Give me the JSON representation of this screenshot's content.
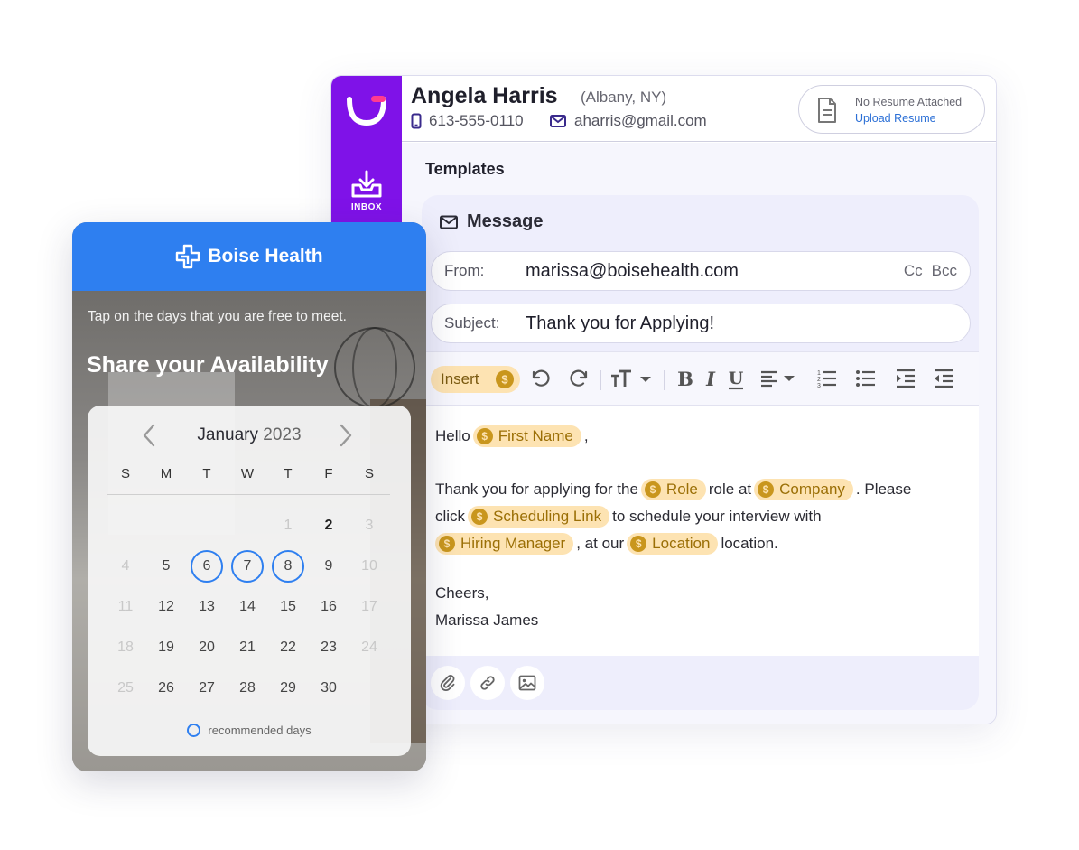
{
  "contact": {
    "name": "Angela Harris",
    "location": "(Albany, NY)",
    "phone": "613-555-0110",
    "email": "aharris@gmail.com",
    "resume_status": "No Resume Attached",
    "resume_action": "Upload Resume"
  },
  "sidebar": {
    "inbox_label": "INBOX"
  },
  "templates_title": "Templates",
  "message": {
    "title": "Message",
    "from_label": "From:",
    "from_value": "marissa@boisehealth.com",
    "cc_label": "Cc",
    "bcc_label": "Bcc",
    "subject_label": "Subject:",
    "subject_value": "Thank you for Applying!",
    "insert_label": "Insert",
    "body": {
      "greeting": "Hello",
      "greeting_end": ",",
      "p1_a": "Thank you for applying for the",
      "p1_b": "role at",
      "p1_c": ". Please",
      "p2_a": "click",
      "p2_b": "to schedule your interview with",
      "p3_b": ", at our",
      "p3_c": "location.",
      "signoff": "Cheers,",
      "signature": "Marissa James"
    },
    "tokens": {
      "first_name": "First Name",
      "role": "Role",
      "company": "Company",
      "scheduling_link": "Scheduling Link",
      "hiring_manager": "Hiring Manager",
      "location": "Location"
    }
  },
  "availability": {
    "brand": "Boise Health",
    "instruction": "Tap on the days that you are free to meet.",
    "title": "Share your Availability",
    "month": "January",
    "year": "2023",
    "weekdays": [
      "S",
      "M",
      "T",
      "W",
      "T",
      "F",
      "S"
    ],
    "weeks": [
      [
        null,
        null,
        null,
        null,
        "1",
        "2",
        "3"
      ],
      [
        "4",
        "5",
        "6",
        "7",
        "8",
        "9",
        "10"
      ],
      [
        "11",
        "12",
        "13",
        "14",
        "15",
        "16",
        "17"
      ],
      [
        "18",
        "19",
        "20",
        "21",
        "22",
        "23",
        "24"
      ],
      [
        "25",
        "26",
        "27",
        "28",
        "29",
        "30",
        null
      ]
    ],
    "recommended_days": [
      "6",
      "7",
      "8"
    ],
    "legend": "recommended days"
  },
  "colors": {
    "sidebar_purple": "#7f12e8",
    "brand_blue": "#2e7ff0",
    "token_bg": "#fde3b2",
    "token_text": "#9b6f06",
    "link_blue": "#2b6fd6"
  }
}
